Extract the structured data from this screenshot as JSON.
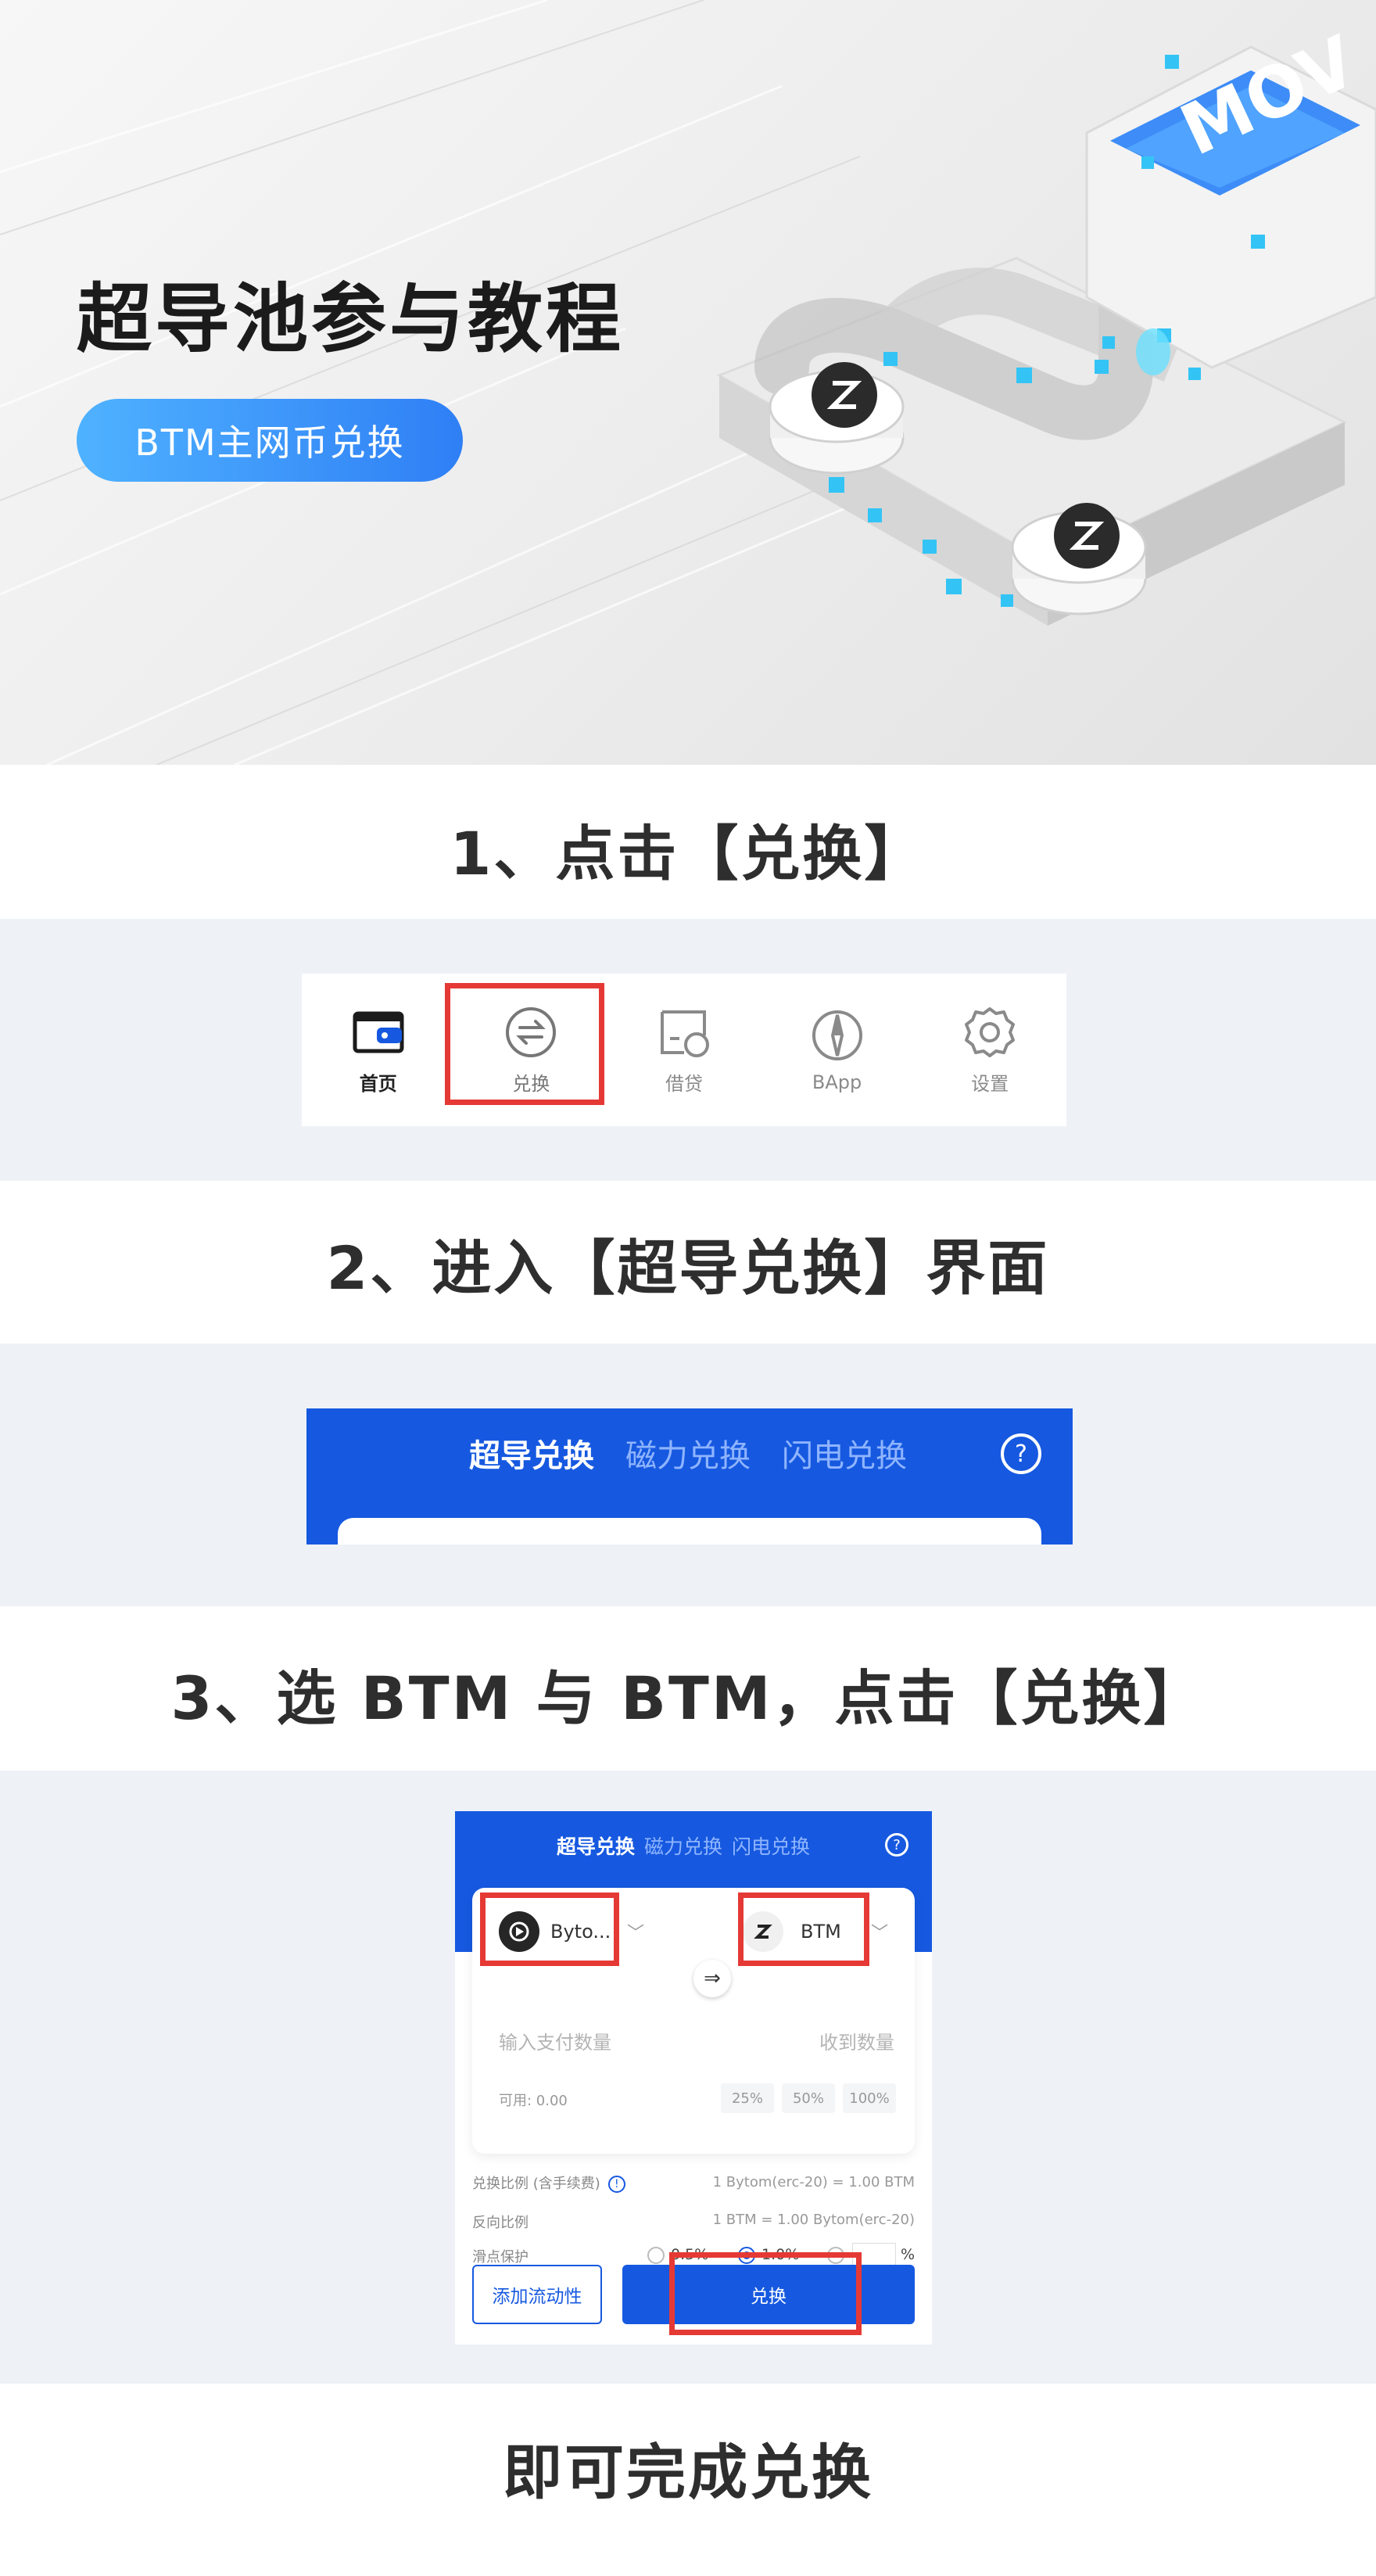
{
  "hero": {
    "title": "超导池参与教程",
    "pill": "BTM主网币兑换",
    "art_text": "MOV"
  },
  "steps": {
    "step1": "1、点击【兑换】",
    "step2": "2、进入【超导兑换】界面",
    "step3": "3、选 BTM 与 BTM，点击【兑换】",
    "done": "即可完成兑换"
  },
  "tabbar": {
    "items": [
      {
        "label": "首页",
        "icon": "wallet-icon"
      },
      {
        "label": "兑换",
        "icon": "exchange-icon"
      },
      {
        "label": "借贷",
        "icon": "loan-icon"
      },
      {
        "label": "BApp",
        "icon": "compass-icon"
      },
      {
        "label": "设置",
        "icon": "gear-icon"
      }
    ]
  },
  "swap_header": {
    "tabs": [
      "超导兑换",
      "磁力兑换",
      "闪电兑换"
    ],
    "help": "?"
  },
  "swap_screen": {
    "tabs": [
      "超导兑换",
      "磁力兑换",
      "闪电兑换"
    ],
    "help": "?",
    "from_token": "Byto...",
    "to_token": "BTM",
    "swap_arrow": "⇒",
    "pay_placeholder": "输入支付数量",
    "receive_placeholder": "收到数量",
    "available": "可用: 0.00",
    "percents": [
      "25%",
      "50%",
      "100%"
    ],
    "rate_label": "兑换比例 (含手续费)",
    "rate_value": "1 Bytom(erc-20) = 1.00 BTM",
    "reverse_label": "反向比例",
    "reverse_value": "1 BTM = 1.00 Bytom(erc-20)",
    "slippage_label": "滑点保护",
    "slippage_options": [
      "0.5%",
      "1.0%",
      "%"
    ],
    "add_liquidity": "添加流动性",
    "swap_button": "兑换"
  },
  "colors": {
    "brand_blue": "#1659e0",
    "highlight_red": "#e53935",
    "band_bg": "#eef2f6"
  }
}
